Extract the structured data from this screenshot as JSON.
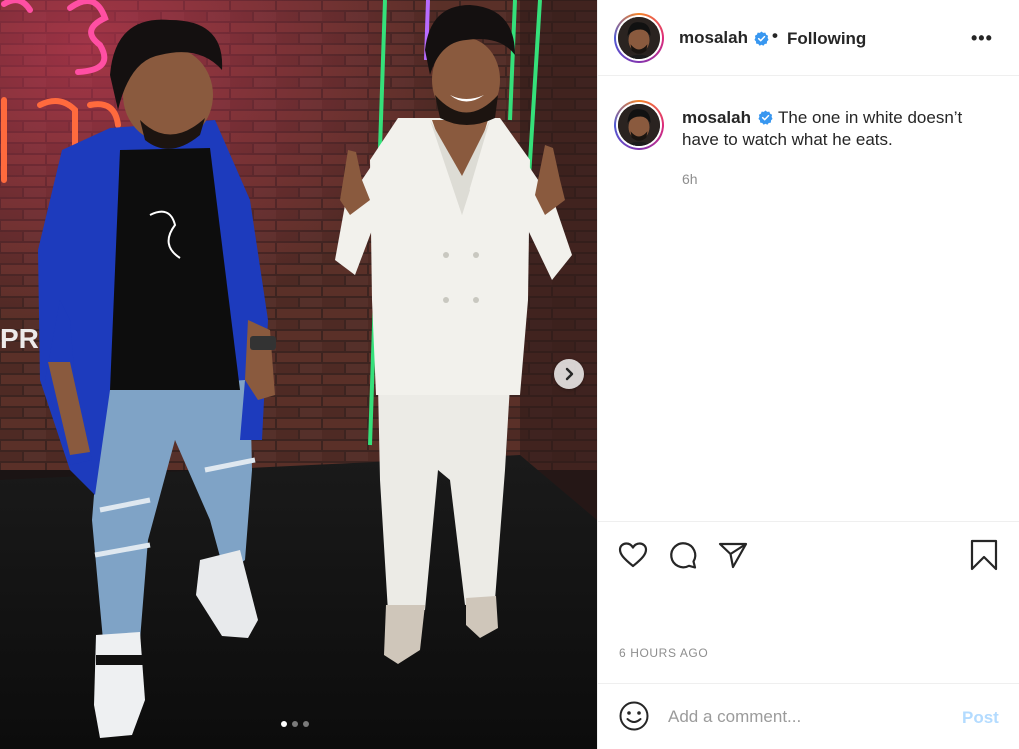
{
  "header": {
    "username": "mosalah",
    "separator": "•",
    "follow_status": "Following",
    "more_label": "•••"
  },
  "caption": {
    "username": "mosalah",
    "text": "The one in white doesn’t have to watch what he eats.",
    "time": "6h"
  },
  "photo": {
    "sign_text": "PRE",
    "carousel": {
      "count": 3,
      "active_index": 1
    }
  },
  "actions": [
    "heart-icon",
    "comment-icon",
    "share-icon",
    "bookmark-icon"
  ],
  "timestamp": "6 HOURS AGO",
  "comment_box": {
    "placeholder": "Add a comment...",
    "post_label": "Post"
  },
  "colors": {
    "verified": "#3897f0",
    "post_disabled": "#b3dbff",
    "muted_text": "#8e8e8e",
    "border": "#efefef"
  }
}
